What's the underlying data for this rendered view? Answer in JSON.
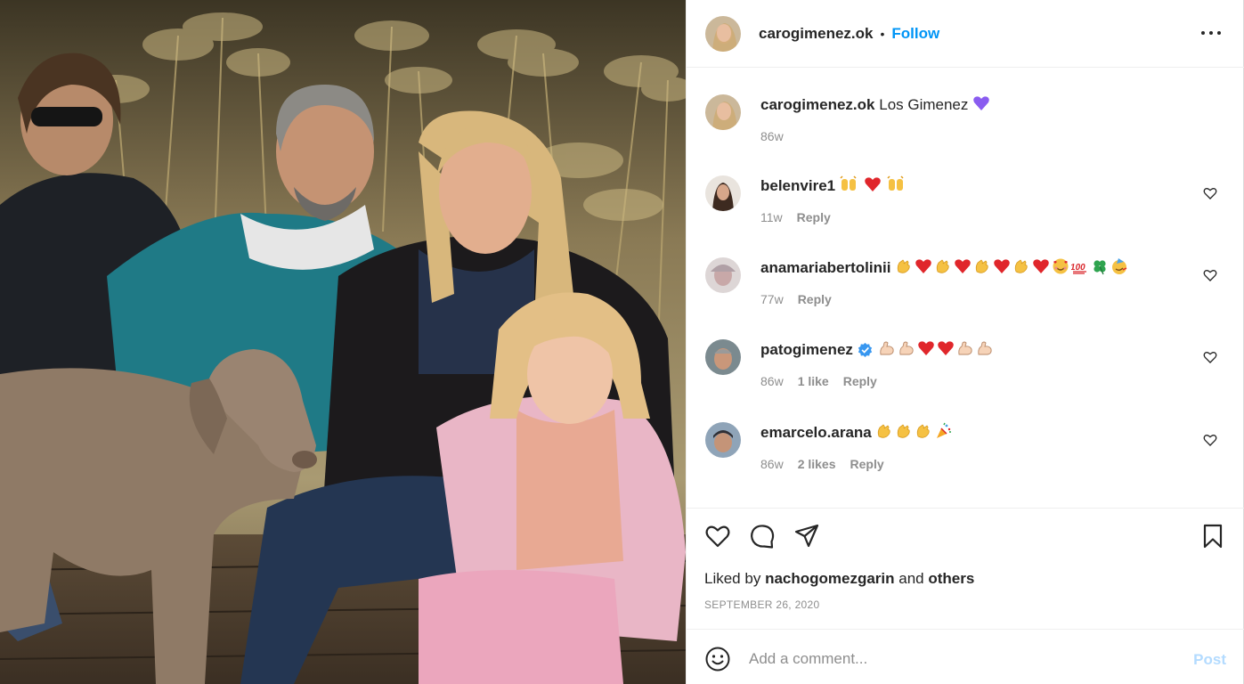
{
  "post": {
    "author": "carogimenez.ok",
    "follow_label": "Follow",
    "header_separator": "•"
  },
  "caption": {
    "username": "carogimenez.ok",
    "text": "Los Gimenez",
    "emoji": "purple-heart",
    "time": "86w"
  },
  "comments": [
    {
      "username": "belenvire1",
      "emojis": [
        "raised-hands",
        "red-heart",
        "raised-hands"
      ],
      "time": "11w",
      "likes": "",
      "reply": "Reply",
      "verified": false
    },
    {
      "username": "anamariabertolinii",
      "emojis": [
        "clapping-hands",
        "red-heart",
        "clapping-hands",
        "red-heart",
        "clapping-hands",
        "red-heart",
        "clapping-hands",
        "red-heart",
        "smiling-face-with-hearts",
        "hundred-points",
        "four-leaf-clover",
        "partying-face"
      ],
      "time": "77w",
      "likes": "",
      "reply": "Reply",
      "verified": false
    },
    {
      "username": "patogimenez",
      "emojis": [
        "flexed-biceps",
        "flexed-biceps",
        "red-heart",
        "red-heart",
        "flexed-biceps",
        "flexed-biceps"
      ],
      "time": "86w",
      "likes": "1 like",
      "reply": "Reply",
      "verified": true
    },
    {
      "username": "emarcelo.arana",
      "emojis": [
        "clapping-hands",
        "clapping-hands",
        "clapping-hands",
        "party-popper"
      ],
      "time": "86w",
      "likes": "2 likes",
      "reply": "Reply",
      "verified": false
    }
  ],
  "actions": {
    "liked_prefix": "Liked by",
    "liked_user": "nachogomezgarin",
    "liked_and": "and",
    "liked_others": "others",
    "date": "SEPTEMBER 26, 2020"
  },
  "add_comment": {
    "placeholder": "Add a comment...",
    "post_label": "Post"
  },
  "colors": {
    "link_blue": "#0095f6",
    "post_disabled": "#b3dbff",
    "secondary_text": "#8e8e8e",
    "verified_blue": "#3897f0"
  },
  "icons": {
    "more": "more-horizontal-icon",
    "like": "heart-icon",
    "comment": "comment-icon",
    "share": "paper-plane-icon",
    "save": "bookmark-icon",
    "emoji": "smiley-icon"
  }
}
